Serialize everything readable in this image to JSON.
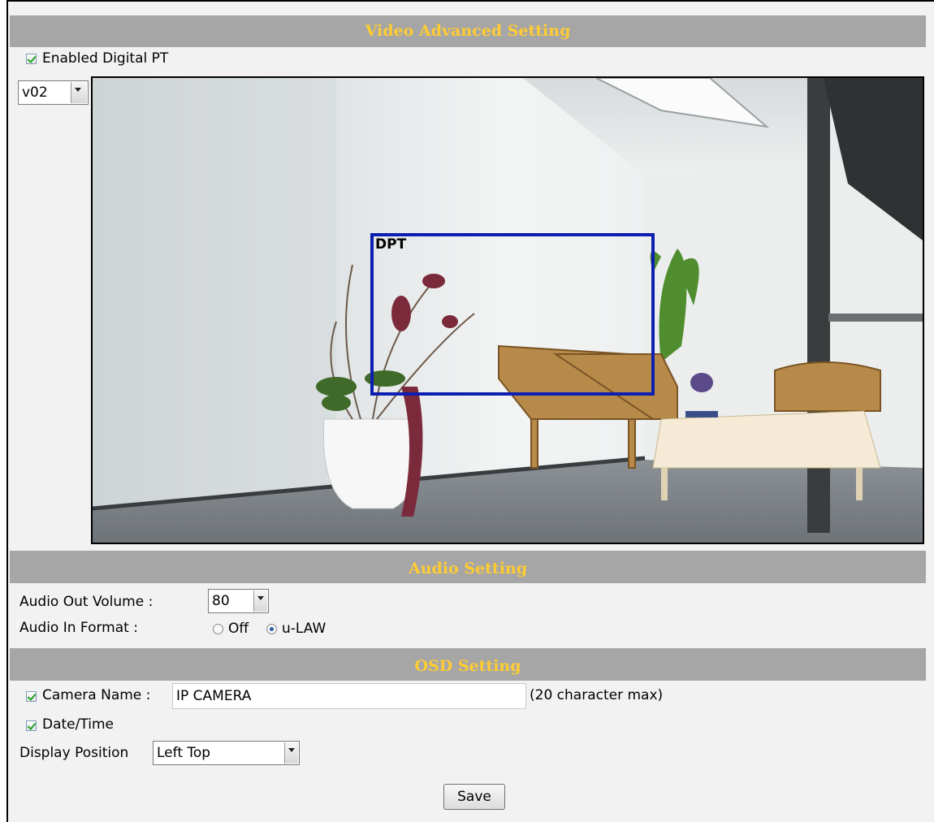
{
  "video": {
    "header": "Video Advanced Setting",
    "enable_dpt_label": "Enabled Digital PT",
    "enable_dpt_checked": true,
    "stream_select_value": "v02",
    "dpt_box_label": "DPT"
  },
  "audio": {
    "header": "Audio Setting",
    "out_volume_label": "Audio Out Volume :",
    "out_volume_value": "80",
    "in_format_label": "Audio In Format :",
    "in_format_options": [
      "Off",
      "u-LAW"
    ],
    "in_format_selected": "u-LAW"
  },
  "osd": {
    "header": "OSD Setting",
    "camera_name_label": "Camera Name :",
    "camera_name_checked": true,
    "camera_name_value": "IP CAMERA",
    "camera_name_hint": "(20 character max)",
    "datetime_label": "Date/Time",
    "datetime_checked": true,
    "display_position_label": "Display Position",
    "display_position_value": "Left Top"
  },
  "actions": {
    "save_label": "Save"
  },
  "colors": {
    "header_bg": "#a6a6a6",
    "header_text": "#ffcc33",
    "dpt_box": "#0d1fb0"
  }
}
